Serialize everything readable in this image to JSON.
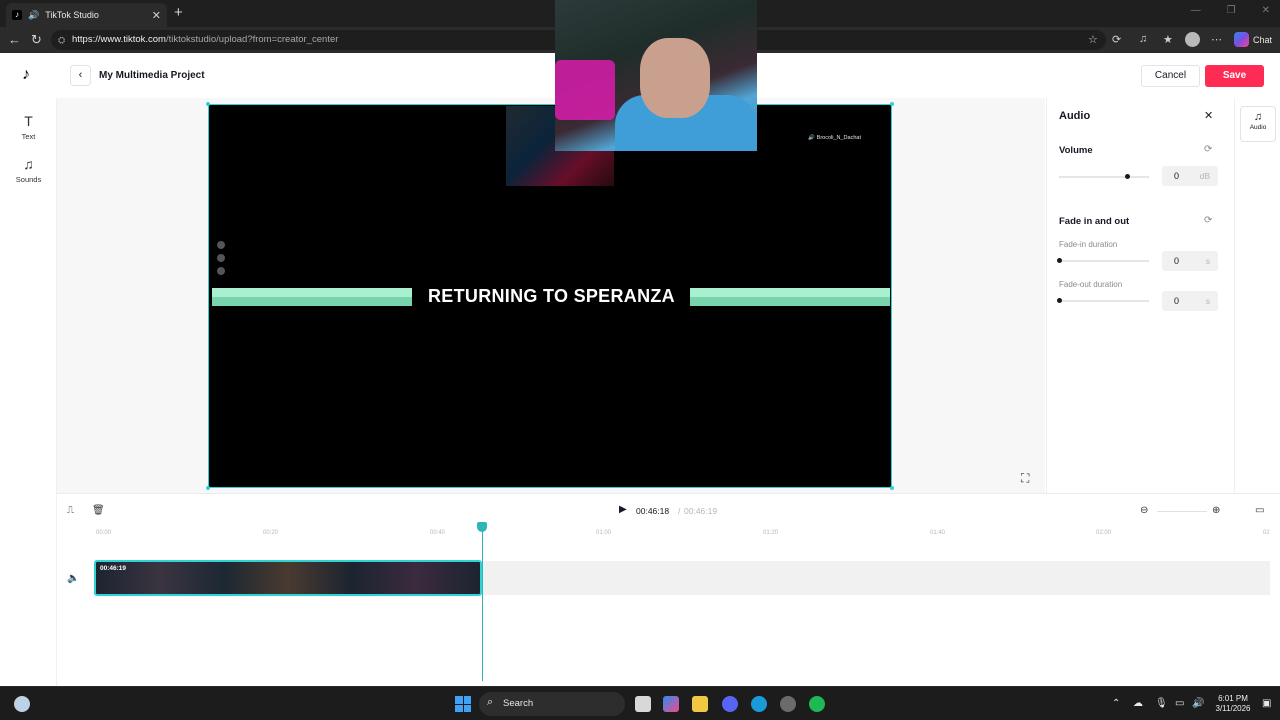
{
  "browser": {
    "tab_title": "TikTok Studio",
    "url_domain": "https://www.tiktok.com",
    "url_path": "/tiktokstudio/upload?from=creator_center",
    "chat_label": "Chat"
  },
  "header": {
    "project_title": "My Multimedia Project",
    "cancel_label": "Cancel",
    "save_label": "Save"
  },
  "left_rail": [
    {
      "label": "Text",
      "icon": "text-icon"
    },
    {
      "label": "Sounds",
      "icon": "music-note-icon"
    }
  ],
  "video": {
    "banner_text": "RETURNING TO SPERANZA",
    "overlay_tag": "🔊 Brocoli_N_Dachat"
  },
  "audio_panel": {
    "title": "Audio",
    "volume": {
      "label": "Volume",
      "value": "0",
      "unit": "dB",
      "slider_fraction": 0.75
    },
    "fade": {
      "label": "Fade in and out"
    },
    "fade_in": {
      "label": "Fade-in duration",
      "value": "0",
      "unit": "s",
      "slider_fraction": 0
    },
    "fade_out": {
      "label": "Fade-out duration",
      "value": "0",
      "unit": "s",
      "slider_fraction": 0
    }
  },
  "right_rail": {
    "label": "Audio",
    "icon": "music-note-icon"
  },
  "timeline": {
    "current_time": "00:46:18",
    "separator": "/",
    "total_time": "00:46:19",
    "clip_duration": "00:46:19",
    "ruler": [
      "00:00",
      "00:20",
      "00:40",
      "01:00",
      "01:20",
      "01:40",
      "02:00",
      "02"
    ]
  },
  "taskbar": {
    "search_label": "Search",
    "time": "6:01 PM",
    "date": "3/11/2026"
  },
  "colors": {
    "accent": "#fe2c55",
    "selection": "#2fd3d3",
    "banner": "#a8f0cf"
  }
}
